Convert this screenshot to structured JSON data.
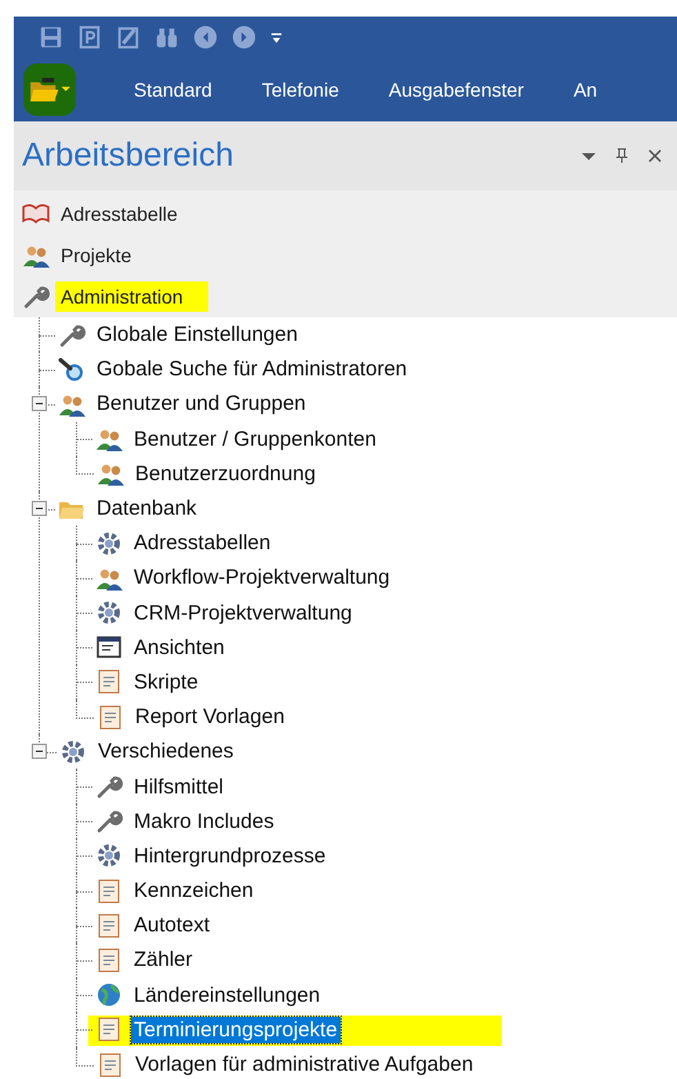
{
  "app_menu": {
    "highlighted": true
  },
  "ribbon_tabs": [
    {
      "label": "Standard"
    },
    {
      "label": "Telefonie"
    },
    {
      "label": "Ausgabefenster"
    },
    {
      "label": "An"
    }
  ],
  "panel": {
    "title": "Arbeitsbereich"
  },
  "nav_items": [
    {
      "label": "Adresstabelle",
      "highlighted": false
    },
    {
      "label": "Projekte",
      "highlighted": false
    },
    {
      "label": "Administration",
      "highlighted": true
    }
  ],
  "tree": [
    {
      "label": "Globale Einstellungen",
      "selected": false,
      "highlighted": false
    },
    {
      "label": "Gobale Suche für Administratoren",
      "selected": false,
      "highlighted": false
    },
    {
      "label": "Benutzer und Gruppen",
      "selected": false,
      "highlighted": false,
      "expanded": true,
      "children": [
        {
          "label": "Benutzer / Gruppenkonten",
          "selected": false,
          "highlighted": false
        },
        {
          "label": "Benutzerzuordnung",
          "selected": false,
          "highlighted": false
        }
      ]
    },
    {
      "label": "Datenbank",
      "selected": false,
      "highlighted": false,
      "expanded": true,
      "children": [
        {
          "label": "Adresstabellen",
          "selected": false,
          "highlighted": false
        },
        {
          "label": "Workflow-Projektverwaltung",
          "selected": false,
          "highlighted": false
        },
        {
          "label": "CRM-Projektverwaltung",
          "selected": false,
          "highlighted": false
        },
        {
          "label": "Ansichten",
          "selected": false,
          "highlighted": false
        },
        {
          "label": "Skripte",
          "selected": false,
          "highlighted": false
        },
        {
          "label": "Report Vorlagen",
          "selected": false,
          "highlighted": false
        }
      ]
    },
    {
      "label": "Verschiedenes",
      "selected": false,
      "highlighted": false,
      "expanded": true,
      "children": [
        {
          "label": "Hilfsmittel",
          "selected": false,
          "highlighted": false
        },
        {
          "label": "Makro Includes",
          "selected": false,
          "highlighted": false
        },
        {
          "label": "Hintergrundprozesse",
          "selected": false,
          "highlighted": false
        },
        {
          "label": "Kennzeichen",
          "selected": false,
          "highlighted": false
        },
        {
          "label": "Autotext",
          "selected": false,
          "highlighted": false
        },
        {
          "label": "Zähler",
          "selected": false,
          "highlighted": false
        },
        {
          "label": "Ländereinstellungen",
          "selected": false,
          "highlighted": false
        },
        {
          "label": "Terminierungsprojekte",
          "selected": true,
          "highlighted": true
        },
        {
          "label": "Vorlagen für administrative Aufgaben",
          "selected": false,
          "highlighted": false
        }
      ]
    }
  ]
}
